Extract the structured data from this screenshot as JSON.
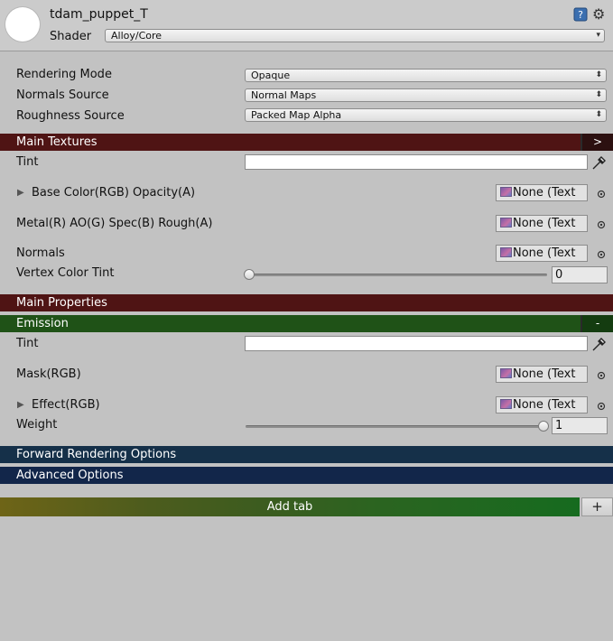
{
  "header": {
    "material_name": "tdam_puppet_T",
    "shader_label": "Shader",
    "shader_value": "Alloy/Core"
  },
  "dropdowns": [
    {
      "label": "Rendering Mode",
      "value": "Opaque"
    },
    {
      "label": "Normals Source",
      "value": "Normal Maps"
    },
    {
      "label": "Roughness Source",
      "value": "Packed Map Alpha"
    }
  ],
  "sections": {
    "main_textures": {
      "title": "Main Textures",
      "button": ">",
      "color": "#4f1414"
    },
    "main_properties": {
      "title": "Main Properties",
      "color": "#4f1414"
    },
    "emission": {
      "title": "Emission",
      "button": "-",
      "color": "#1f5217"
    },
    "forward_rendering": {
      "title": "Forward Rendering Options",
      "color": "#153049"
    },
    "advanced": {
      "title": "Advanced Options",
      "color": "#12264a"
    }
  },
  "main_textures": {
    "tint_label": "Tint",
    "base_color_label": "Base Color(RGB) Opacity(A)",
    "metal_label": "Metal(R) AO(G) Spec(B) Rough(A)",
    "normals_label": "Normals",
    "texture_none": "None (Text",
    "vertex_tint_label": "Vertex Color Tint",
    "vertex_tint_value": "0",
    "vertex_tint_fraction": 0
  },
  "emission": {
    "tint_label": "Tint",
    "mask_label": "Mask(RGB)",
    "effect_label": "Effect(RGB)",
    "texture_none": "None (Text",
    "weight_label": "Weight",
    "weight_value": "1",
    "weight_fraction": 1
  },
  "footer": {
    "add_tab_label": "Add tab",
    "plus_label": "+"
  }
}
